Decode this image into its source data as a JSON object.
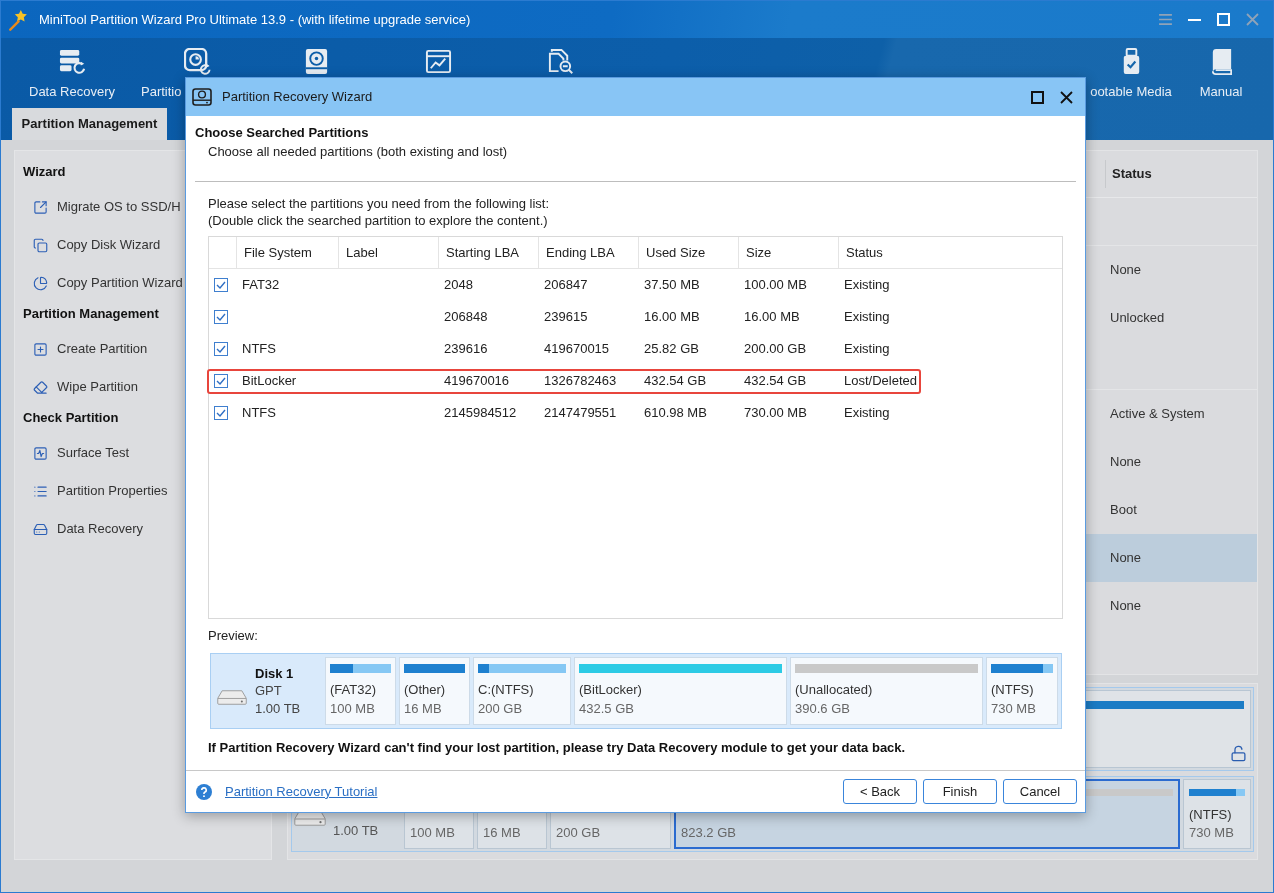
{
  "app": {
    "title": "MiniTool Partition Wizard Pro Ultimate 13.9 - (with lifetime upgrade service)",
    "toolbar": {
      "left_items": [
        {
          "kind": "labeled",
          "label": "Data Recovery"
        },
        {
          "kind": "labeled",
          "label": "Partitio"
        },
        {
          "kind": "icon_only"
        },
        {
          "kind": "icon_only"
        },
        {
          "kind": "icon_only"
        }
      ],
      "right_items": [
        {
          "label": "ootable Media"
        },
        {
          "label": "Manual"
        }
      ]
    },
    "tabs": [
      {
        "label": "Partition Management",
        "selected": true
      }
    ],
    "sidebar": [
      {
        "heading": "Wizard",
        "items": [
          "Migrate OS to SSD/H",
          "Copy Disk Wizard",
          "Copy Partition Wizard"
        ]
      },
      {
        "heading": "Partition Management",
        "items": [
          "Create Partition",
          "Wipe Partition"
        ]
      },
      {
        "heading": "Check Partition",
        "items": [
          "Surface Test",
          "Partition Properties",
          "Data Recovery"
        ]
      }
    ],
    "partition_table": {
      "columns": [
        "Status"
      ],
      "disks": [
        {
          "partitions": [
            {
              "status": "None",
              "selected": false
            },
            {
              "status": "Unlocked",
              "selected": false
            }
          ]
        },
        {
          "partitions": [
            {
              "status": "Active & System",
              "selected": false
            },
            {
              "status": "None",
              "selected": false
            },
            {
              "status": "Boot",
              "selected": false
            },
            {
              "status": "None",
              "selected": true
            },
            {
              "status": "None",
              "selected": false
            }
          ]
        }
      ]
    },
    "disk_map": {
      "disk_size": "1.00 TB",
      "partitions": [
        {
          "size": "100 MB",
          "selected": false
        },
        {
          "size": "16 MB",
          "selected": false
        },
        {
          "size": "200 GB",
          "selected": false
        },
        {
          "size": "823.2 GB",
          "kind": "unallocated",
          "selected": true
        },
        {
          "label": "(NTFS)",
          "size": "730 MB",
          "kind": "normal",
          "level": 0.84,
          "selected": false
        }
      ]
    }
  },
  "dialog": {
    "title": "Partition Recovery Wizard",
    "heading": "Choose Searched Partitions",
    "subheading": "Choose all needed partitions (both existing and lost)",
    "instructions": [
      "Please select the partitions you need from the following list:",
      "(Double click the searched partition to explore the content.)"
    ],
    "table": {
      "columns": [
        "File System",
        "Label",
        "Starting LBA",
        "Ending LBA",
        "Used Size",
        "Size",
        "Status"
      ],
      "rows": [
        {
          "checked": true,
          "highlighted": false,
          "file_system": "FAT32",
          "starting_lba": "2048",
          "ending_lba": "206847",
          "used_size": "37.50 MB",
          "size": "100.00 MB",
          "status": "Existing"
        },
        {
          "checked": true,
          "highlighted": false,
          "starting_lba": "206848",
          "ending_lba": "239615",
          "used_size": "16.00 MB",
          "size": "16.00 MB",
          "status": "Existing"
        },
        {
          "checked": true,
          "highlighted": false,
          "file_system": "NTFS",
          "starting_lba": "239616",
          "ending_lba": "419670015",
          "used_size": "25.82 GB",
          "size": "200.00 GB",
          "status": "Existing"
        },
        {
          "checked": true,
          "highlighted": true,
          "file_system": "BitLocker",
          "starting_lba": "419670016",
          "ending_lba": "1326782463",
          "used_size": "432.54 GB",
          "size": "432.54 GB",
          "status": "Lost/Deleted"
        },
        {
          "checked": true,
          "highlighted": false,
          "file_system": "NTFS",
          "starting_lba": "2145984512",
          "ending_lba": "2147479551",
          "used_size": "610.98 MB",
          "size": "730.00 MB",
          "status": "Existing"
        }
      ]
    },
    "preview": {
      "label": "Preview:",
      "disk": {
        "name": "Disk 1",
        "type": "GPT",
        "size": "1.00 TB"
      },
      "partitions": [
        {
          "kind": "normal",
          "level": 0.375,
          "label": "(FAT32)",
          "size": "100 MB"
        },
        {
          "kind": "normal",
          "level": 1,
          "label": "(Other)",
          "size": "16 MB"
        },
        {
          "kind": "normal",
          "level": 0.13,
          "label": "C:(NTFS)",
          "size": "200 GB"
        },
        {
          "kind": "bitlocker",
          "level": 1,
          "label": "(BitLocker)",
          "size": "432.5 GB"
        },
        {
          "kind": "unallocated",
          "label": "(Unallocated)",
          "size": "390.6 GB"
        },
        {
          "kind": "normal",
          "level": 0.84,
          "label": "(NTFS)",
          "size": "730 MB"
        }
      ]
    },
    "notice": "If Partition Recovery Wizard can't find your lost partition, please try Data Recovery module to get your data back.",
    "help_link": "Partition Recovery Tutorial",
    "buttons": [
      "< Back",
      "Finish",
      "Cancel"
    ]
  }
}
